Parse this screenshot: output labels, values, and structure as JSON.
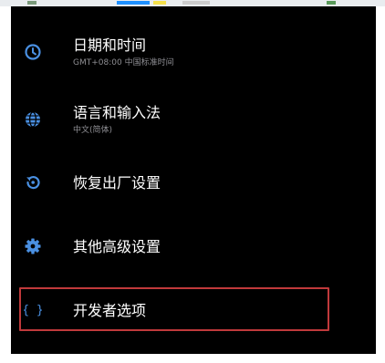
{
  "colors": {
    "background": "#000000",
    "title_text": "#ffffff",
    "subtitle_text": "#8e8e93",
    "icon_accent": "#4a90e2",
    "highlight_border": "#c0393b"
  },
  "settings": {
    "items": [
      {
        "title": "日期和时间",
        "subtitle": "GMT+08:00 中国标准时间",
        "icon": "clock-icon"
      },
      {
        "title": "语言和输入法",
        "subtitle": "中文(简体)",
        "icon": "globe-icon"
      },
      {
        "title": "恢复出厂设置",
        "subtitle": "",
        "icon": "restore-icon"
      },
      {
        "title": "其他高级设置",
        "subtitle": "",
        "icon": "gear-icon"
      },
      {
        "title": "开发者选项",
        "subtitle": "",
        "icon": "braces-icon",
        "highlighted": true
      }
    ]
  }
}
